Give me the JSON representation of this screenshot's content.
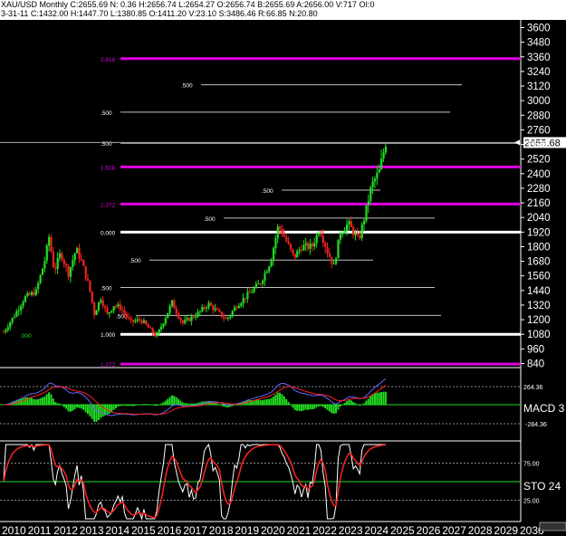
{
  "header": {
    "line1": "XAU/USD Monthly  C:2655.69  N: 0.36  H:2656.74  L:2654.27  O:2656.74  B:2655.69  A:2656.00  V:717  OI:0",
    "line2": "3-31-11  C:1432.00  H:1447.70  L:1380.85  O:1411.20  V:23.10  S:3486.46  R:66.85  N:20.80"
  },
  "chart_data": [
    {
      "type": "candlestick",
      "panel": "price",
      "y_ticks": [
        3600,
        3480,
        3360,
        3240,
        3120,
        3000,
        2880,
        2760,
        2640,
        2520,
        2400,
        2280,
        2160,
        2040,
        1920,
        1800,
        1680,
        1560,
        1440,
        1320,
        1200,
        1080,
        960,
        840
      ],
      "last_price": "2655.68",
      "x_labels": [
        "2010",
        "2011",
        "2012",
        "2013",
        "2014",
        "2015",
        "2016",
        "2017",
        "2018",
        "2019",
        "2020",
        "2021",
        "2022",
        "2023",
        "2024",
        "2025",
        "2026",
        "2027",
        "2028",
        "2029",
        "2030"
      ],
      "ohlc_anchor_points": [
        [
          2010.0,
          1100
        ],
        [
          2010.4,
          1230
        ],
        [
          2010.8,
          1380
        ],
        [
          2011.25,
          1432
        ],
        [
          2011.6,
          1700
        ],
        [
          2011.75,
          1880
        ],
        [
          2011.95,
          1600
        ],
        [
          2012.2,
          1750
        ],
        [
          2012.5,
          1580
        ],
        [
          2012.8,
          1780
        ],
        [
          2013.0,
          1680
        ],
        [
          2013.3,
          1470
        ],
        [
          2013.5,
          1250
        ],
        [
          2013.75,
          1380
        ],
        [
          2014.0,
          1240
        ],
        [
          2014.25,
          1320
        ],
        [
          2014.5,
          1300
        ],
        [
          2014.9,
          1180
        ],
        [
          2015.3,
          1200
        ],
        [
          2015.9,
          1060
        ],
        [
          2016.5,
          1340
        ],
        [
          2016.9,
          1170
        ],
        [
          2017.5,
          1250
        ],
        [
          2017.9,
          1330
        ],
        [
          2018.6,
          1200
        ],
        [
          2019.0,
          1320
        ],
        [
          2019.5,
          1420
        ],
        [
          2019.9,
          1500
        ],
        [
          2020.3,
          1680
        ],
        [
          2020.6,
          1970
        ],
        [
          2020.8,
          1900
        ],
        [
          2021.2,
          1710
        ],
        [
          2021.5,
          1800
        ],
        [
          2021.9,
          1800
        ],
        [
          2022.2,
          1950
        ],
        [
          2022.5,
          1760
        ],
        [
          2022.75,
          1640
        ],
        [
          2023.0,
          1920
        ],
        [
          2023.3,
          1990
        ],
        [
          2023.7,
          1850
        ],
        [
          2023.95,
          2060
        ],
        [
          2024.2,
          2300
        ],
        [
          2024.5,
          2420
        ],
        [
          2024.75,
          2655.69
        ]
      ],
      "fib_levels": [
        {
          "label": "2.618",
          "value": 3345,
          "color": "#e000e0",
          "thick": true
        },
        {
          "label": ".500",
          "value": 3130,
          "color": "#c0c0c0",
          "thick": false
        },
        {
          "label": ".500",
          "value": 2905,
          "color": "#c0c0c0",
          "thick": false
        },
        {
          "label": ".500",
          "value": 2650,
          "color": "#c0c0c0",
          "thick": false
        },
        {
          "label": "1.618",
          "value": 2455,
          "color": "#e000e0",
          "thick": true
        },
        {
          "label": ".500",
          "value": 2265,
          "color": "#c0c0c0",
          "thick": false
        },
        {
          "label": "1.272",
          "value": 2150,
          "color": "#e000e0",
          "thick": true
        },
        {
          "label": ".500",
          "value": 2035,
          "color": "#c0c0c0",
          "thick": false
        },
        {
          "label": "0.000",
          "value": 1920,
          "color": "#ffffff",
          "thick": true
        },
        {
          "label": ".500",
          "value": 1690,
          "color": "#c0c0c0",
          "thick": false
        },
        {
          "label": ".500",
          "value": 1465,
          "color": "#c0c0c0",
          "thick": false
        },
        {
          "label": ".500",
          "value": 1235,
          "color": "#c0c0c0",
          "thick": false
        },
        {
          "label": "1.000",
          "value": 1080,
          "color": "#ffffff",
          "thick": true
        },
        {
          "label": "1.272",
          "value": 835,
          "color": "#e000e0",
          "thick": true
        }
      ],
      "misc_labels": [
        ".000"
      ],
      "up_color": "#22dd22",
      "down_color": "#ee2222"
    },
    {
      "type": "line",
      "panel": "macd",
      "label": "MACD 3",
      "y_ticks": [
        "264.36",
        "-284.36"
      ],
      "macd_color": "#6666ff",
      "signal_color": "#ff2222",
      "hist_color": "#22dd22"
    },
    {
      "type": "line",
      "panel": "stochastic",
      "label": "STO  24",
      "y_ticks": [
        "75.00",
        "25.00"
      ],
      "k_color": "#ffffff",
      "d_color": "#ff2222"
    }
  ]
}
